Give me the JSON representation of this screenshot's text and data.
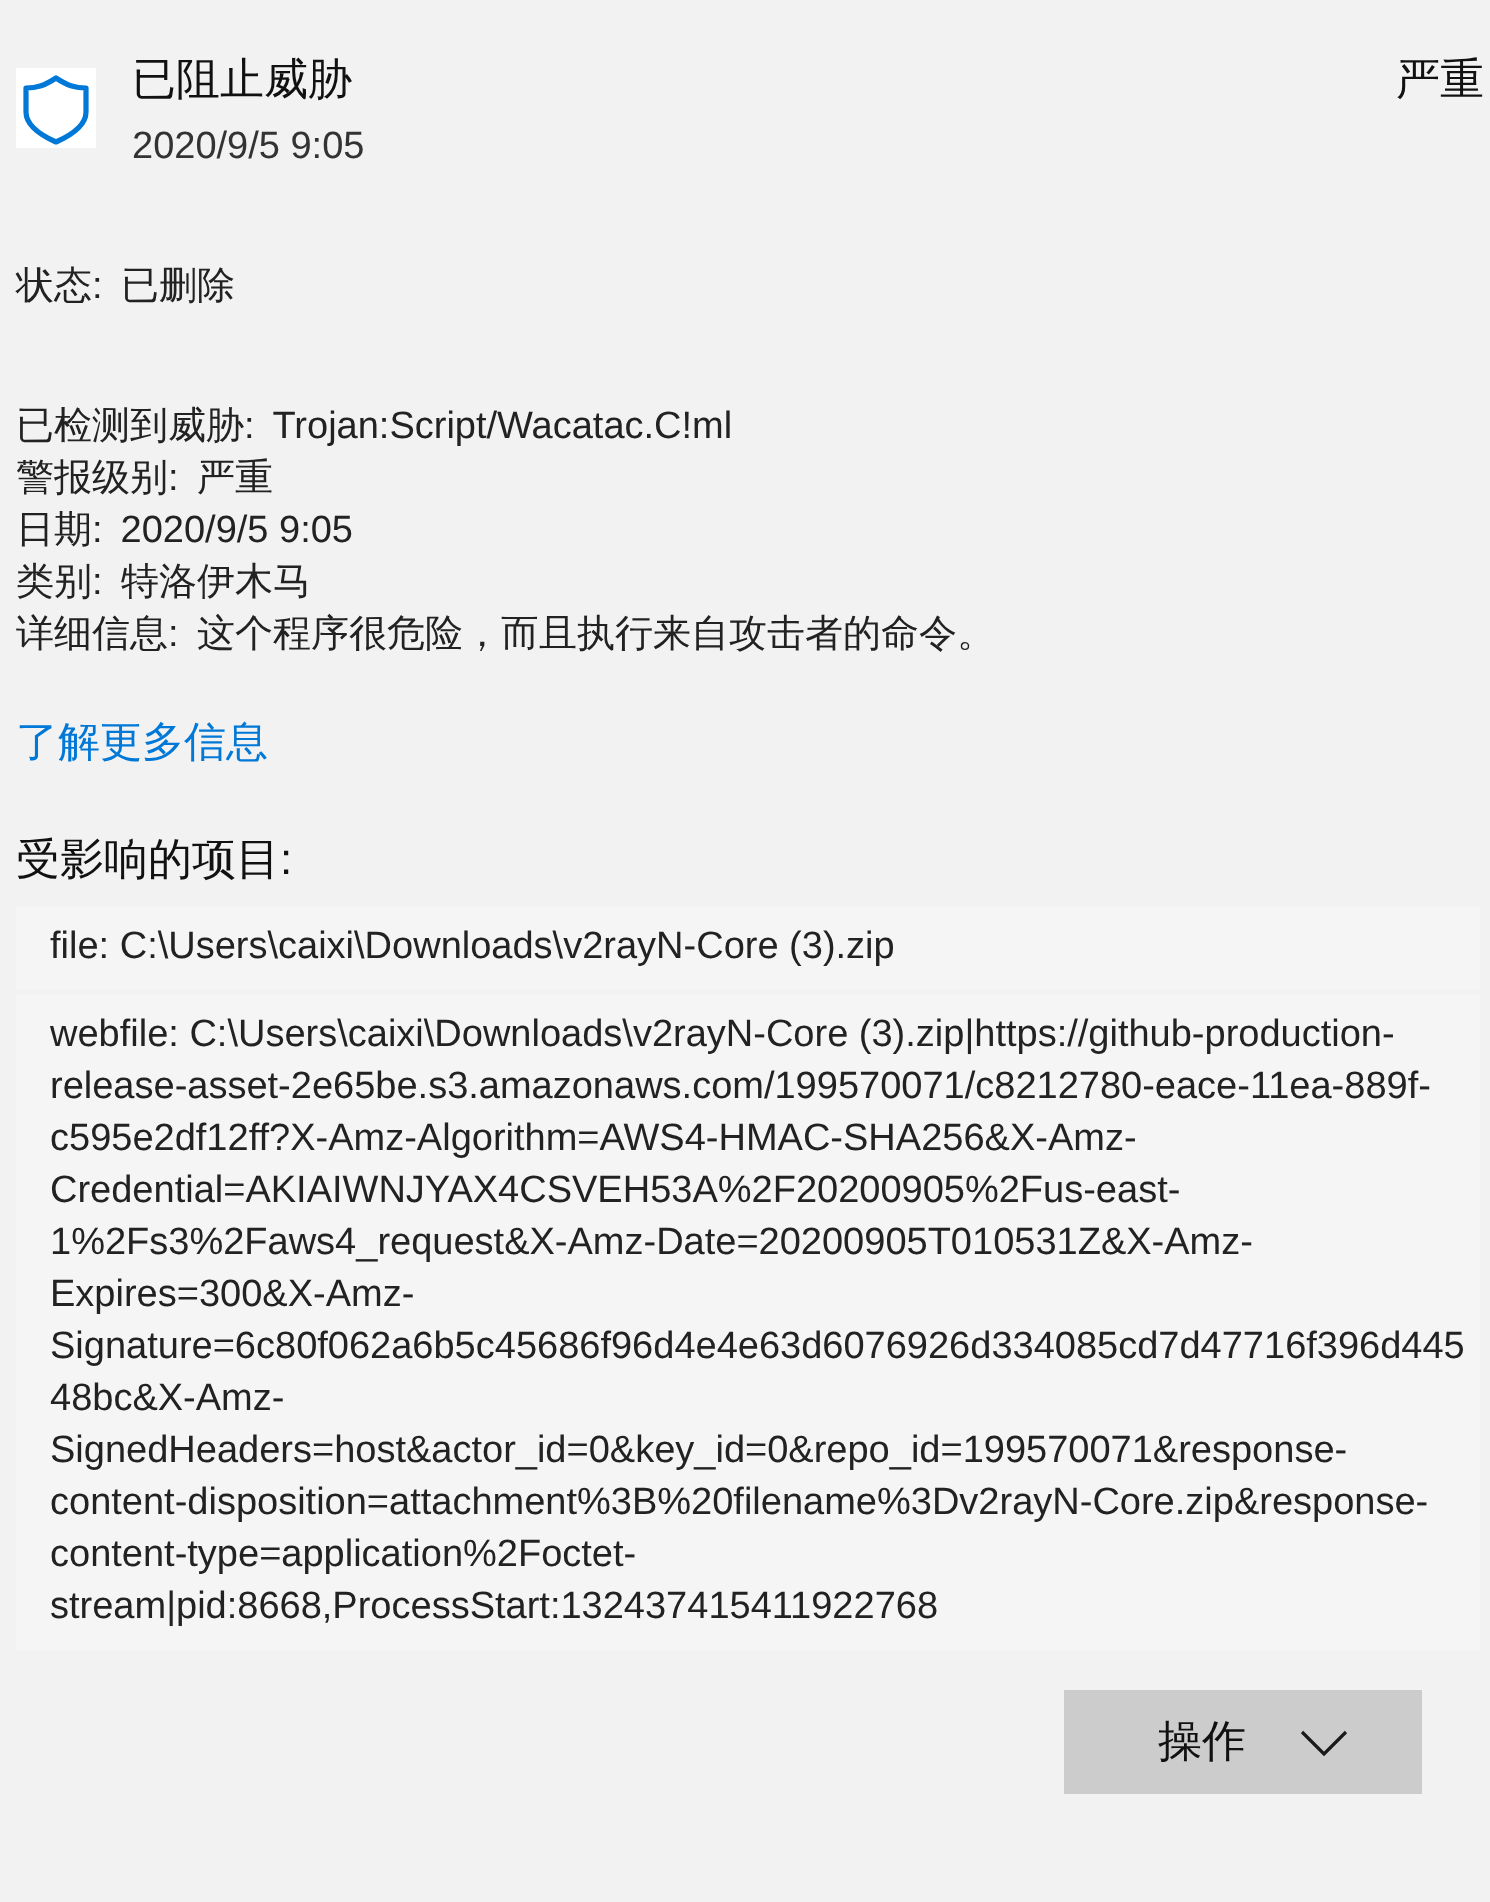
{
  "header": {
    "title": "已阻止威胁",
    "date": "2020/9/5 9:05",
    "severity": "严重"
  },
  "status": {
    "label": "状态:",
    "value": "已删除"
  },
  "details": [
    {
      "label": "已检测到威胁:",
      "value": "Trojan:Script/Wacatac.C!ml"
    },
    {
      "label": "警报级别:",
      "value": "严重"
    },
    {
      "label": "日期:",
      "value": "2020/9/5 9:05"
    },
    {
      "label": "类别:",
      "value": "特洛伊木马"
    },
    {
      "label": "详细信息:",
      "value": "这个程序很危险，而且执行来自攻击者的命令。"
    }
  ],
  "learn_more_link": "了解更多信息",
  "affected_items": {
    "heading": "受影响的项目:",
    "items": [
      "file: C:\\Users\\caixi\\Downloads\\v2rayN-Core (3).zip",
      "webfile: C:\\Users\\caixi\\Downloads\\v2rayN-Core (3).zip|https://github-production-release-asset-2e65be.s3.amazonaws.com/199570071/c8212780-eace-11ea-889f-c595e2df12ff?X-Amz-Algorithm=AWS4-HMAC-SHA256&X-Amz-Credential=AKIAIWNJYAX4CSVEH53A%2F20200905%2Fus-east-1%2Fs3%2Faws4_request&X-Amz-Date=20200905T010531Z&X-Amz-Expires=300&X-Amz-Signature=6c80f062a6b5c45686f96d4e4e63d6076926d334085cd7d47716f396d44548bc&X-Amz-SignedHeaders=host&actor_id=0&key_id=0&repo_id=199570071&response-content-disposition=attachment%3B%20filename%3Dv2rayN-Core.zip&response-content-type=application%2Foctet-stream|pid:8668,ProcessStart:132437415411922768"
    ]
  },
  "actions_button": {
    "label": "操作"
  }
}
